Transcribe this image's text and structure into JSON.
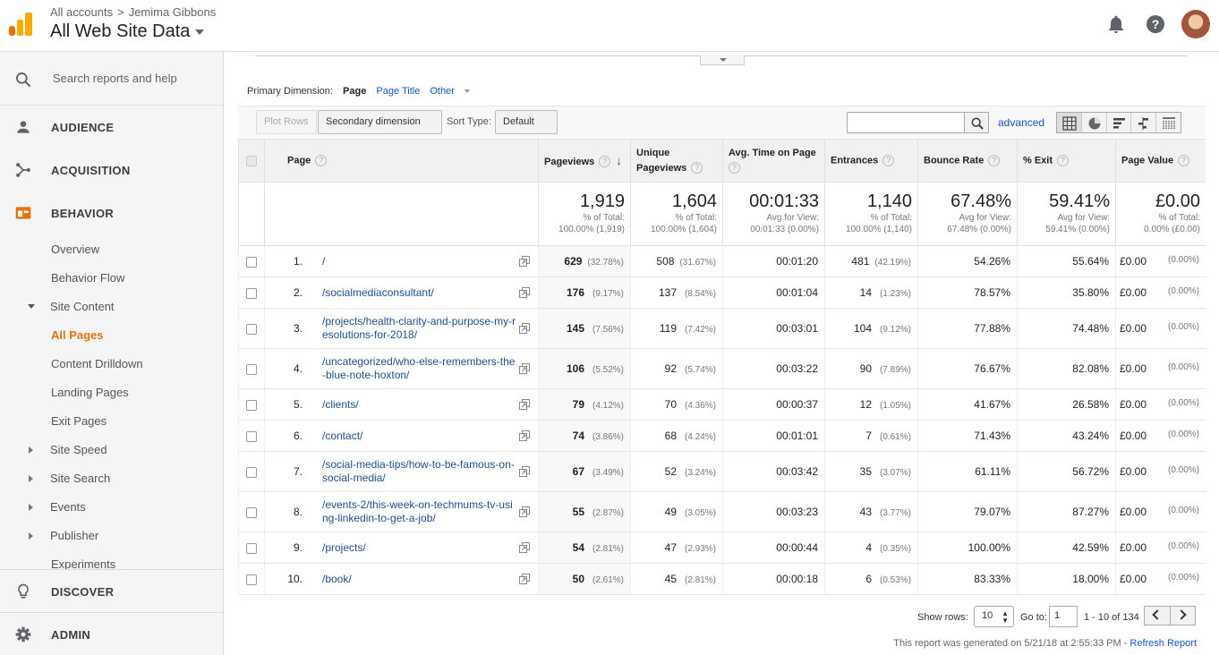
{
  "header": {
    "breadcrumb_root": "All accounts",
    "breadcrumb_sep": ">",
    "account": "Jemima Gibbons",
    "property": "All Web Site Data",
    "logo": "analytics-logo-icon",
    "icons": [
      "bell-icon",
      "help-icon",
      "user-avatar"
    ]
  },
  "sidebar": {
    "search_placeholder": "Search reports and help",
    "sections": {
      "audience": "AUDIENCE",
      "acquisition": "ACQUISITION",
      "behavior": "BEHAVIOR",
      "discover": "DISCOVER",
      "admin": "ADMIN"
    },
    "behavior_items": {
      "overview": "Overview",
      "behavior_flow": "Behavior Flow",
      "site_content": "Site Content",
      "all_pages": "All Pages",
      "content_drilldown": "Content Drilldown",
      "landing_pages": "Landing Pages",
      "exit_pages": "Exit Pages",
      "site_speed": "Site Speed",
      "site_search": "Site Search",
      "events": "Events",
      "publisher": "Publisher",
      "experiments": "Experiments"
    },
    "accent_color": "#e8710a"
  },
  "primary_dimension": {
    "label": "Primary Dimension:",
    "current": "Page",
    "options": [
      "Page Title",
      "Other"
    ]
  },
  "toolbar": {
    "plot_rows": "Plot Rows",
    "secondary_dimension": "Secondary dimension",
    "sort_type_label": "Sort Type:",
    "sort_type_value": "Default",
    "advanced": "advanced",
    "views": [
      "table-view-icon",
      "pie-view-icon",
      "bar-view-icon",
      "comparison-view-icon",
      "pivot-view-icon"
    ]
  },
  "table": {
    "columns": {
      "page": "Page",
      "pageviews": "Pageviews",
      "unique_pageviews": "Unique Pageviews",
      "avg_time": "Avg. Time on Page",
      "entrances": "Entrances",
      "bounce_rate": "Bounce Rate",
      "exit": "% Exit",
      "page_value": "Page Value"
    },
    "totals": {
      "pageviews": {
        "value": "1,919",
        "l1": "% of Total:",
        "l2": "100.00% (1,919)"
      },
      "unique_pageviews": {
        "value": "1,604",
        "l1": "% of Total:",
        "l2": "100.00% (1,604)"
      },
      "avg_time": {
        "value": "00:01:33",
        "l1": "Avg for View:",
        "l2": "00:01:33 (0.00%)"
      },
      "entrances": {
        "value": "1,140",
        "l1": "% of Total:",
        "l2": "100.00% (1,140)"
      },
      "bounce_rate": {
        "value": "67.48%",
        "l1": "Avg for View:",
        "l2": "67.48% (0.00%)"
      },
      "exit": {
        "value": "59.41%",
        "l1": "Avg for View:",
        "l2": "59.41% (0.00%)"
      },
      "page_value": {
        "value": "£0.00",
        "l1": "% of Total:",
        "l2": "0.00% (£0.00)"
      }
    },
    "rows": [
      {
        "num": "1.",
        "page": "/",
        "pv": "629",
        "pv_pct": "(32.78%)",
        "upv": "508",
        "upv_pct": "(31.67%)",
        "time": "00:01:20",
        "ent": "481",
        "ent_pct": "(42.19%)",
        "bounce": "54.26%",
        "exit": "55.64%",
        "val": "£0.00",
        "val_pct": "(0.00%)"
      },
      {
        "num": "2.",
        "page": "/socialmediaconsultant/",
        "pv": "176",
        "pv_pct": "(9.17%)",
        "upv": "137",
        "upv_pct": "(8.54%)",
        "time": "00:01:04",
        "ent": "14",
        "ent_pct": "(1.23%)",
        "bounce": "78.57%",
        "exit": "35.80%",
        "val": "£0.00",
        "val_pct": "(0.00%)"
      },
      {
        "num": "3.",
        "page": "/projects/health-clarity-and-purpose-my-resolutions-for-2018/",
        "pv": "145",
        "pv_pct": "(7.56%)",
        "upv": "119",
        "upv_pct": "(7.42%)",
        "time": "00:03:01",
        "ent": "104",
        "ent_pct": "(9.12%)",
        "bounce": "77.88%",
        "exit": "74.48%",
        "val": "£0.00",
        "val_pct": "(0.00%)"
      },
      {
        "num": "4.",
        "page": "/uncategorized/who-else-remembers-the-blue-note-hoxton/",
        "pv": "106",
        "pv_pct": "(5.52%)",
        "upv": "92",
        "upv_pct": "(5.74%)",
        "time": "00:03:22",
        "ent": "90",
        "ent_pct": "(7.89%)",
        "bounce": "76.67%",
        "exit": "82.08%",
        "val": "£0.00",
        "val_pct": "(0.00%)"
      },
      {
        "num": "5.",
        "page": "/clients/",
        "pv": "79",
        "pv_pct": "(4.12%)",
        "upv": "70",
        "upv_pct": "(4.36%)",
        "time": "00:00:37",
        "ent": "12",
        "ent_pct": "(1.05%)",
        "bounce": "41.67%",
        "exit": "26.58%",
        "val": "£0.00",
        "val_pct": "(0.00%)"
      },
      {
        "num": "6.",
        "page": "/contact/",
        "pv": "74",
        "pv_pct": "(3.86%)",
        "upv": "68",
        "upv_pct": "(4.24%)",
        "time": "00:01:01",
        "ent": "7",
        "ent_pct": "(0.61%)",
        "bounce": "71.43%",
        "exit": "43.24%",
        "val": "£0.00",
        "val_pct": "(0.00%)"
      },
      {
        "num": "7.",
        "page": "/social-media-tips/how-to-be-famous-on-social-media/",
        "pv": "67",
        "pv_pct": "(3.49%)",
        "upv": "52",
        "upv_pct": "(3.24%)",
        "time": "00:03:42",
        "ent": "35",
        "ent_pct": "(3.07%)",
        "bounce": "61.11%",
        "exit": "56.72%",
        "val": "£0.00",
        "val_pct": "(0.00%)"
      },
      {
        "num": "8.",
        "page": "/events-2/this-week-on-techmums-tv-using-linkedin-to-get-a-job/",
        "pv": "55",
        "pv_pct": "(2.87%)",
        "upv": "49",
        "upv_pct": "(3.05%)",
        "time": "00:03:23",
        "ent": "43",
        "ent_pct": "(3.77%)",
        "bounce": "79.07%",
        "exit": "87.27%",
        "val": "£0.00",
        "val_pct": "(0.00%)"
      },
      {
        "num": "9.",
        "page": "/projects/",
        "pv": "54",
        "pv_pct": "(2.81%)",
        "upv": "47",
        "upv_pct": "(2.93%)",
        "time": "00:00:44",
        "ent": "4",
        "ent_pct": "(0.35%)",
        "bounce": "100.00%",
        "exit": "42.59%",
        "val": "£0.00",
        "val_pct": "(0.00%)"
      },
      {
        "num": "10.",
        "page": "/book/",
        "pv": "50",
        "pv_pct": "(2.61%)",
        "upv": "45",
        "upv_pct": "(2.81%)",
        "time": "00:00:18",
        "ent": "6",
        "ent_pct": "(0.53%)",
        "bounce": "83.33%",
        "exit": "18.00%",
        "val": "£0.00",
        "val_pct": "(0.00%)"
      }
    ]
  },
  "pager": {
    "show_rows_label": "Show rows:",
    "show_rows_value": "10",
    "goto_label": "Go to:",
    "goto_value": "1",
    "range": "1 - 10 of 134",
    "generated": "This report was generated on 5/21/18 at 2:55:33 PM -",
    "refresh": "Refresh Report"
  }
}
